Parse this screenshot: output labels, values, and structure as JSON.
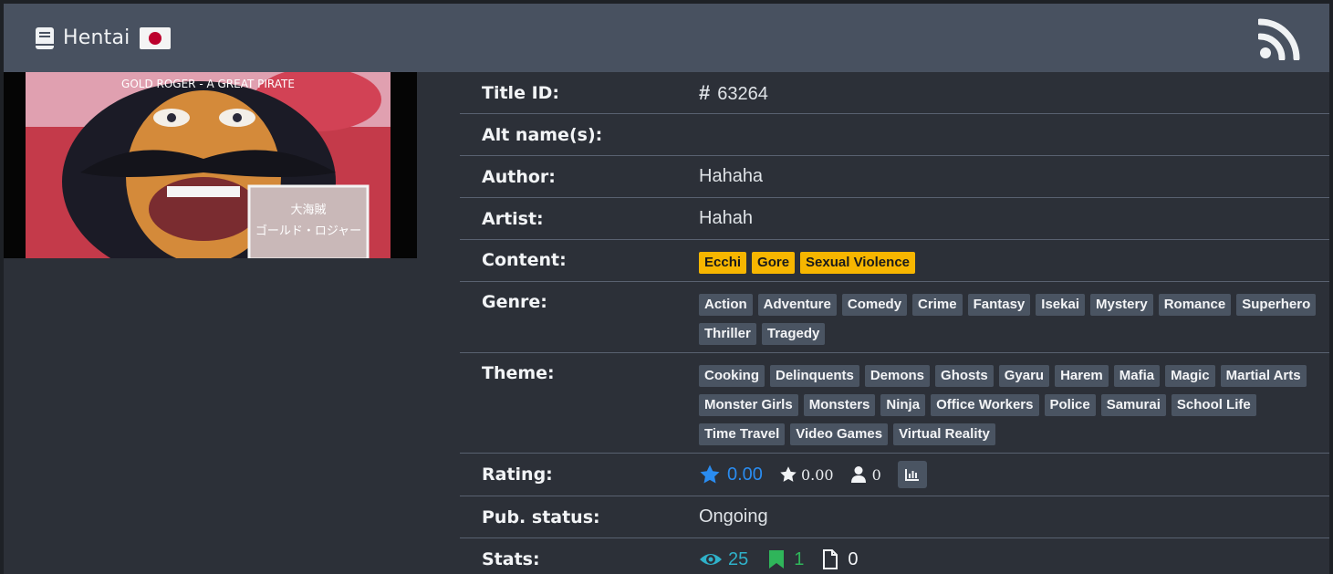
{
  "header": {
    "title": "Hentai",
    "book_icon": "book-icon",
    "flag_icon": "japan-flag-icon",
    "rss_icon": "rss-icon"
  },
  "cover": {
    "caption": "GOLD ROGER - A GREAT PIRATE",
    "jp_title": "大海賊",
    "jp_name": "ゴールド・ロジャー"
  },
  "info": {
    "title_id": {
      "label": "Title ID:",
      "icon": "hash-icon",
      "value": "63264"
    },
    "alt_names": {
      "label": "Alt name(s):"
    },
    "author": {
      "label": "Author:",
      "value": "Hahaha"
    },
    "artist": {
      "label": "Artist:",
      "value": "Hahah"
    },
    "content": {
      "label": "Content:",
      "tags": [
        "Ecchi",
        "Gore",
        "Sexual Violence"
      ]
    },
    "genre": {
      "label": "Genre:",
      "tags": [
        "Action",
        "Adventure",
        "Comedy",
        "Crime",
        "Fantasy",
        "Isekai",
        "Mystery",
        "Romance",
        "Superhero",
        "Thriller",
        "Tragedy"
      ]
    },
    "theme": {
      "label": "Theme:",
      "tags": [
        "Cooking",
        "Delinquents",
        "Demons",
        "Ghosts",
        "Gyaru",
        "Harem",
        "Mafia",
        "Magic",
        "Martial Arts",
        "Monster Girls",
        "Monsters",
        "Ninja",
        "Office Workers",
        "Police",
        "Samurai",
        "School Life",
        "Time Travel",
        "Video Games",
        "Virtual Reality"
      ]
    },
    "rating": {
      "label": "Rating:",
      "bayesian": "0.00",
      "mean": "0.00",
      "users": "0"
    },
    "pub_status": {
      "label": "Pub. status:",
      "value": "Ongoing"
    },
    "stats": {
      "label": "Stats:",
      "views": "25",
      "follows": "1",
      "chapters": "0"
    }
  },
  "colors": {
    "header_bg": "#485160",
    "card_bg": "#2c3038",
    "tag_bg": "#4a5462",
    "content_tag_bg": "#f7b600",
    "rating_blue": "#2a8cf0",
    "views_teal": "#2fb1c9",
    "follows_green": "#2fb55a"
  }
}
